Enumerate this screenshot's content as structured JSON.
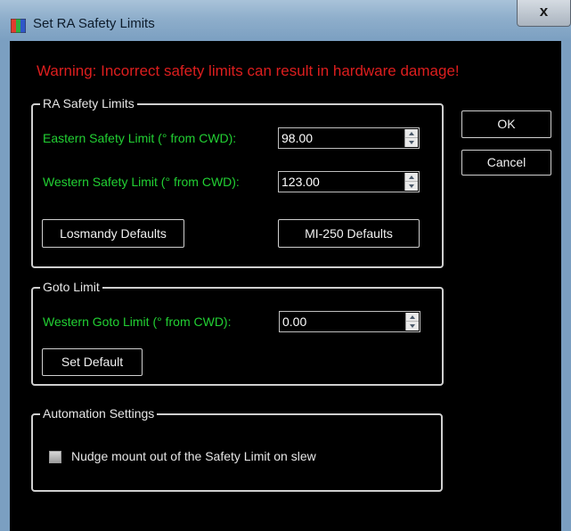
{
  "window": {
    "title": "Set RA Safety Limits",
    "close_label": "x",
    "accent": "#7b9fc1",
    "background": "#000000"
  },
  "warning": {
    "text": "Warning: Incorrect safety limits can result in hardware damage!",
    "color": "#dd1e1e"
  },
  "ra_group": {
    "legend": "RA Safety Limits",
    "eastern_label": "Eastern Safety Limit (° from CWD):",
    "eastern_value": "98.00",
    "western_label": "Western Safety Limit (° from CWD):",
    "western_value": "123.00",
    "losmandy_button": "Losmandy Defaults",
    "mi250_button": "MI-250 Defaults"
  },
  "goto_group": {
    "legend": "Goto Limit",
    "western_goto_label": "Western Goto Limit (° from CWD):",
    "western_goto_value": "0.00",
    "set_default_button": "Set Default"
  },
  "automation_group": {
    "legend": "Automation Settings",
    "nudge_label": "Nudge mount out of the Safety Limit on slew",
    "nudge_checked": false
  },
  "buttons": {
    "ok": "OK",
    "cancel": "Cancel"
  },
  "icons": {
    "app": "color-cube-icon",
    "spin_up": "spin-up-icon",
    "spin_down": "spin-down-icon"
  },
  "label_color": "#22d033"
}
